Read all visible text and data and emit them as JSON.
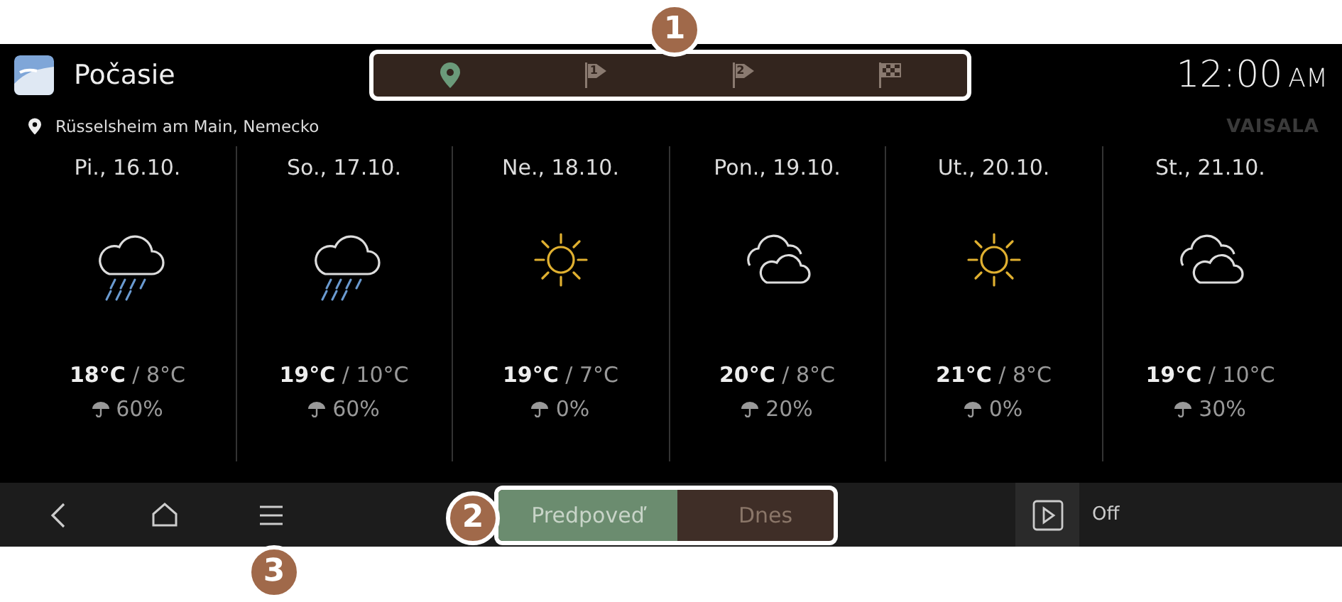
{
  "app": {
    "title": "Počasie"
  },
  "route_tabs": [
    {
      "kind": "location",
      "selected": true
    },
    {
      "kind": "waypoint",
      "label": "1",
      "selected": false
    },
    {
      "kind": "waypoint",
      "label": "2",
      "selected": false
    },
    {
      "kind": "destination",
      "selected": false
    }
  ],
  "clock": {
    "time": "12:00",
    "period": "AM"
  },
  "location": "Rüsselsheim am Main, Nemecko",
  "provider": "VAISALA",
  "days": [
    {
      "date": "Pi., 16.10.",
      "kind": "rain",
      "temperature": "**18°C** / 8°C",
      "precipitation": "60%"
    },
    {
      "date": "So., 17.10.",
      "kind": "rain",
      "temperature": "**19°C** / 10°C",
      "precipitation": "60%"
    },
    {
      "date": "Ne., 18.10.",
      "kind": "sun",
      "temperature": "**19°C** / 7°C",
      "precipitation": "0%"
    },
    {
      "date": "Pon., 19.10.",
      "kind": "cloudy",
      "temperature": "**20°C** / 8°C",
      "precipitation": "20%"
    },
    {
      "date": "Ut., 20.10.",
      "kind": "sun",
      "temperature": "**21°C** / 8°C",
      "precipitation": "0%"
    },
    {
      "date": "St., 21.10.",
      "kind": "cloudy",
      "temperature": "**19°C** / 10°C",
      "precipitation": "30%"
    }
  ],
  "nav_buttons": [
    {
      "kind": "back"
    },
    {
      "kind": "home"
    },
    {
      "kind": "menu"
    }
  ],
  "mode_tabs": [
    {
      "label": "Predpoveď",
      "selected": true
    },
    {
      "label": "Dnes",
      "selected": false
    }
  ],
  "autoplay": {
    "state": "Off"
  },
  "callouts": [
    "1",
    "2",
    "3"
  ]
}
